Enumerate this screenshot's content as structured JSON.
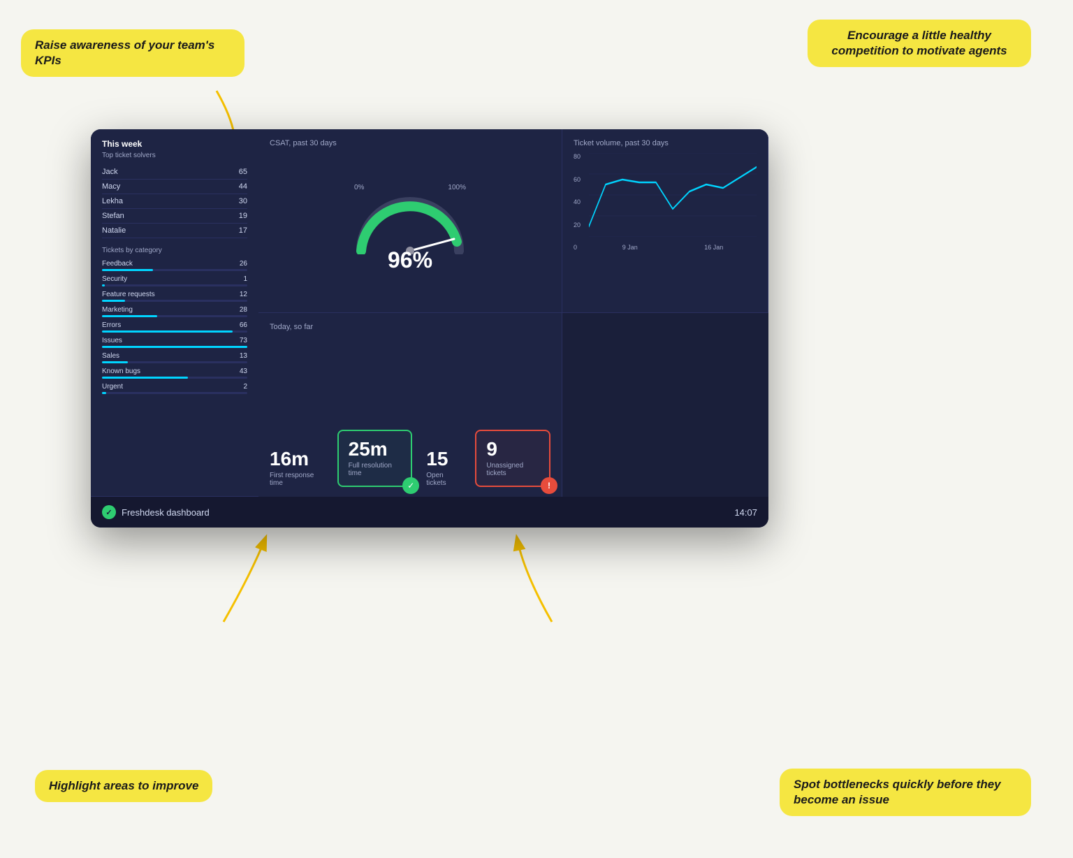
{
  "callouts": {
    "top_left": "Raise awareness of your team's KPIs",
    "top_right": "Encourage a little healthy competition to motivate agents",
    "bottom_left": "Highlight areas to improve",
    "bottom_right": "Spot bottlenecks quickly before they become an issue"
  },
  "csat": {
    "title": "CSAT, past 30 days",
    "value": "96",
    "unit": "%",
    "label_min": "0%",
    "label_max": "100%"
  },
  "volume": {
    "title": "Ticket volume, past 30 days",
    "y_labels": [
      "80",
      "60",
      "40",
      "20",
      "0"
    ],
    "x_labels": [
      "9 Jan",
      "16 Jan"
    ]
  },
  "this_week": {
    "title": "This week",
    "subtitle": "Top ticket solvers",
    "solvers": [
      {
        "name": "Jack",
        "count": 65
      },
      {
        "name": "Macy",
        "count": 44
      },
      {
        "name": "Lekha",
        "count": 30
      },
      {
        "name": "Stefan",
        "count": 19
      },
      {
        "name": "Natalie",
        "count": 17
      }
    ],
    "categories_title": "Tickets by category",
    "categories": [
      {
        "name": "Feedback",
        "count": 26,
        "pct": 35
      },
      {
        "name": "Security",
        "count": 1,
        "pct": 2
      },
      {
        "name": "Feature requests",
        "count": 12,
        "pct": 16
      },
      {
        "name": "Marketing",
        "count": 28,
        "pct": 38
      },
      {
        "name": "Errors",
        "count": 66,
        "pct": 90
      },
      {
        "name": "Issues",
        "count": 73,
        "pct": 100
      },
      {
        "name": "Sales",
        "count": 13,
        "pct": 18
      },
      {
        "name": "Known bugs",
        "count": 43,
        "pct": 59
      },
      {
        "name": "Urgent",
        "count": 2,
        "pct": 3
      }
    ]
  },
  "today": {
    "title": "Today, so far",
    "metrics": [
      {
        "value": "16m",
        "label": "First response time",
        "highlight": "none"
      },
      {
        "value": "25m",
        "label": "Full resolution time",
        "highlight": "green"
      },
      {
        "value": "15",
        "label": "Open tickets",
        "highlight": "none"
      },
      {
        "value": "9",
        "label": "Unassigned tickets",
        "highlight": "red"
      }
    ]
  },
  "bar": {
    "brand": "Freshdesk dashboard",
    "time": "14:07"
  }
}
